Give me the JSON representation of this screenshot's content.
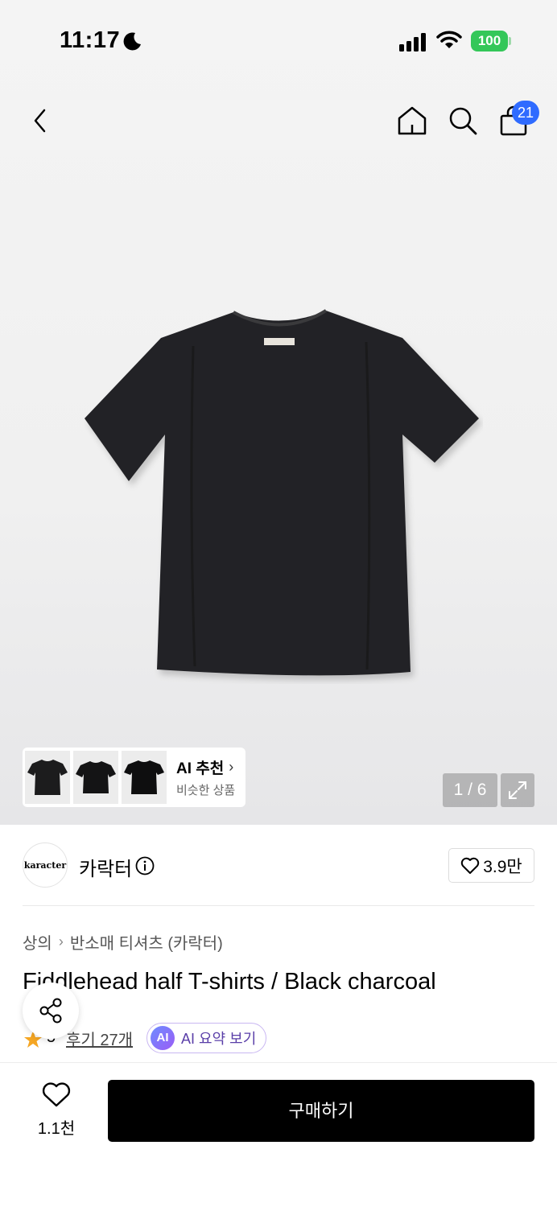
{
  "status_bar": {
    "time": "11:17",
    "battery": "100"
  },
  "nav": {
    "cart_count": "21"
  },
  "gallery": {
    "ai_reco_title": "AI 추천",
    "ai_reco_subtitle": "비슷한 상품",
    "page_indicator": "1 / 6"
  },
  "brand": {
    "logo_text": "karacter",
    "name": "카락터",
    "like_count": "3.9만"
  },
  "breadcrumb": [
    "상의",
    "반소매 티셔츠 (카락터)"
  ],
  "product": {
    "title": "Fiddlehead half T-shirts / Black charcoal",
    "rating": "5",
    "reviews": "후기 27개",
    "ai_summary_badge": "AI",
    "ai_summary": "AI 요약 보기"
  },
  "bottom": {
    "wish_count": "1.1천",
    "buy_label": "구매하기"
  },
  "colors": {
    "accent_blue": "#2f6bff",
    "battery_green": "#34c759",
    "star": "#f5a623"
  }
}
